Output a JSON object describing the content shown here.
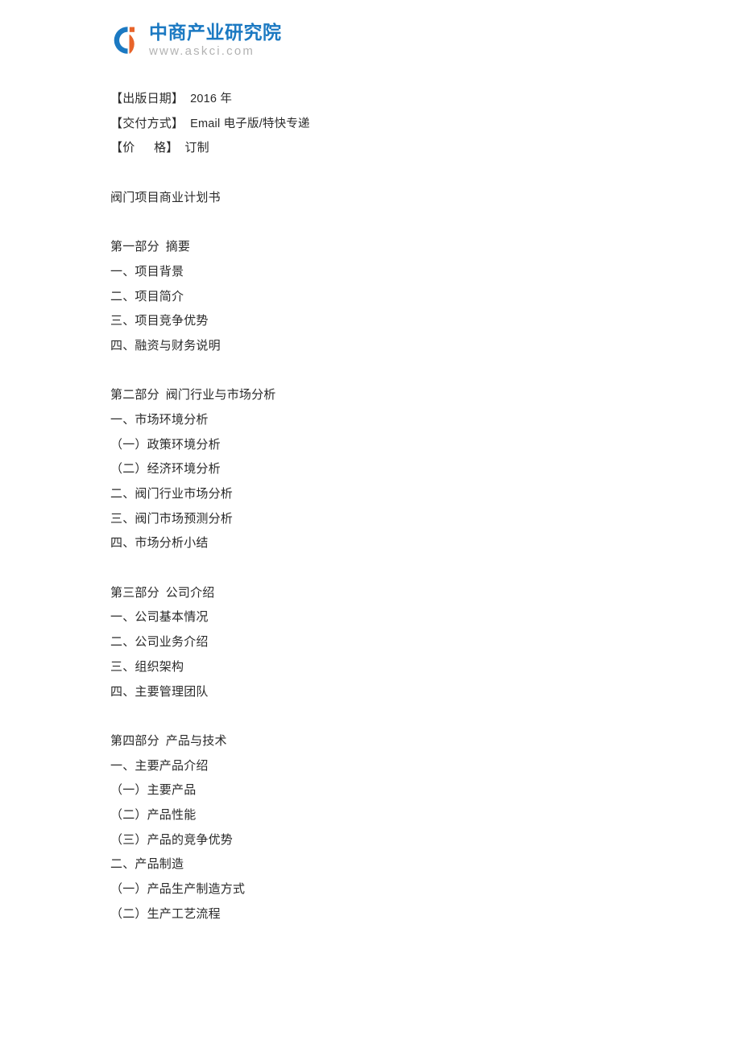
{
  "header": {
    "logo_icon": "askci-circle-logo",
    "brand_cn": "中商产业研究院",
    "brand_url": "www.askci.com",
    "brand_color": "#1b79c2",
    "accent_color": "#e8642a",
    "url_color": "#b3b3b3"
  },
  "document": {
    "meta": [
      {
        "label": "【出版日期】",
        "value": "2016 年"
      },
      {
        "label": "【交付方式】",
        "value": "Email 电子版/特快专递"
      },
      {
        "label": "【价      格】",
        "value": "订制"
      }
    ],
    "title": "阀门项目商业计划书",
    "sections": [
      {
        "heading": "第一部分  摘要",
        "items": [
          "一、项目背景",
          "二、项目简介",
          "三、项目竞争优势",
          "四、融资与财务说明"
        ]
      },
      {
        "heading": "第二部分  阀门行业与市场分析",
        "items": [
          "一、市场环境分析",
          "（一）政策环境分析",
          "（二）经济环境分析",
          "二、阀门行业市场分析",
          "三、阀门市场预测分析",
          "四、市场分析小结"
        ]
      },
      {
        "heading": "第三部分  公司介绍",
        "items": [
          "一、公司基本情况",
          "二、公司业务介绍",
          "三、组织架构",
          "四、主要管理团队"
        ]
      },
      {
        "heading": "第四部分  产品与技术",
        "items": [
          "一、主要产品介绍",
          "（一）主要产品",
          "（二）产品性能",
          "（三）产品的竞争优势",
          "二、产品制造",
          "（一）产品生产制造方式",
          "（二）生产工艺流程"
        ]
      }
    ]
  }
}
